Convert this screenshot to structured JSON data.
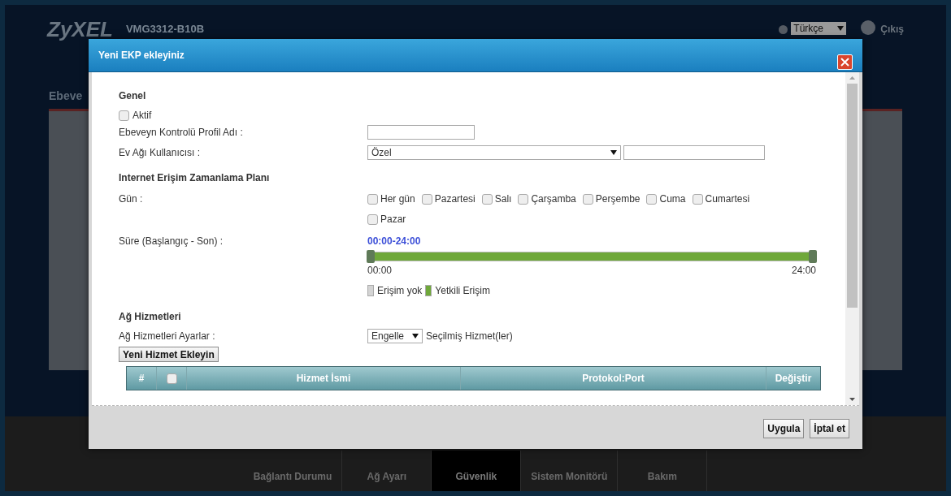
{
  "background": {
    "logo": "ZyXEL",
    "model": "VMG3312-B10B",
    "language": "Türkçe",
    "logout": "Çıkış",
    "page_title": "Ebeve",
    "nav": [
      {
        "label": "Bağlantı Durumu",
        "selected": false
      },
      {
        "label": "Ağ Ayarı",
        "selected": false
      },
      {
        "label": "Güvenlik",
        "selected": true
      },
      {
        "label": "Sistem Monitörü",
        "selected": false
      },
      {
        "label": "Bakım",
        "selected": false
      }
    ]
  },
  "dialog": {
    "title": "Yeni EKP ekleyiniz",
    "general": {
      "heading": "Genel",
      "active": {
        "label": "Aktif",
        "checked": false
      },
      "profile_label": "Ebeveyn Kontrolü Profil Adı :",
      "user_label": "Ev Ağı Kullanıcısı :",
      "user_select": "Özel"
    },
    "schedule": {
      "heading": "Internet Erişim Zamanlama Planı",
      "day_label": "Gün :",
      "days": [
        {
          "label": "Her gün",
          "checked": false
        },
        {
          "label": "Pazartesi",
          "checked": false
        },
        {
          "label": "Salı",
          "checked": false
        },
        {
          "label": "Çarşamba",
          "checked": false
        },
        {
          "label": "Perşembe",
          "checked": false
        },
        {
          "label": "Cuma",
          "checked": false
        },
        {
          "label": "Cumartesi",
          "checked": false
        },
        {
          "label": "Pazar",
          "checked": false
        }
      ],
      "duration_label": "Süre (Başlangıç - Son) :",
      "range": "00:00-24:00",
      "level": 1,
      "start": "00:00",
      "end": "24:00",
      "legend": [
        {
          "label": "Erişim yok",
          "color": "#d4d4d4"
        },
        {
          "label": "Yetkili Erişim",
          "color": "#6fa83a"
        }
      ]
    },
    "services": {
      "heading": "Ağ Hizmetleri",
      "settings_label": "Ağ Hizmetleri Ayarlar :",
      "mode": "Engelle",
      "mode_suffix": "Seçilmiş Hizmet(ler)",
      "add_button": "Yeni Hizmet Ekleyin",
      "columns": [
        "#",
        "Hizmet İsmi",
        "Protokol:Port",
        "Değiştir"
      ],
      "select_all": {
        "checked": false
      }
    },
    "buttons": [
      "Uygula",
      "İptal et"
    ]
  }
}
